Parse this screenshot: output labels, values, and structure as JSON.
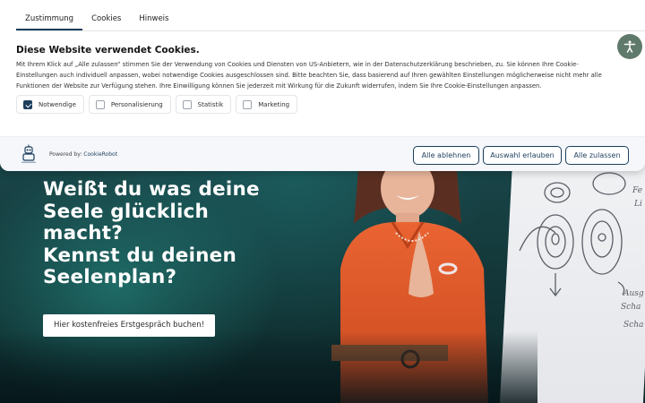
{
  "banner": {
    "tabs": [
      {
        "label": "Zustimmung",
        "active": true
      },
      {
        "label": "Cookies",
        "active": false
      },
      {
        "label": "Hinweis",
        "active": false
      }
    ],
    "title": "Diese Website verwendet Cookies.",
    "description": "Mit Ihrem Klick auf „Alle zulassen“ stimmen Sie der Verwendung von Cookies und Diensten von US-Anbietern, wie in der Datenschutzerklärung beschrieben, zu. Sie können Ihre Cookie-Einstellungen auch individuell anpassen, wobei notwendige Cookies ausgeschlossen sind. Bitte beachten Sie, dass basierend auf Ihren gewählten Einstellungen möglicherweise nicht mehr alle Funktionen der Website zur Verfügung stehen. Ihre Einwilligung können Sie jederzeit mit Wirkung für die Zukunft widerrufen, indem Sie Ihre Cookie-Einstellungen anpassen.",
    "categories": [
      {
        "label": "Notwendige",
        "checked": true
      },
      {
        "label": "Personalisierung",
        "checked": false
      },
      {
        "label": "Statistik",
        "checked": false
      },
      {
        "label": "Marketing",
        "checked": false
      }
    ],
    "powered_prefix": "Powered by:",
    "powered_link": "CookieRobot",
    "buttons": {
      "deny": "Alle ablehnen",
      "selection": "Auswahl erlauben",
      "allow_all": "Alle zulassen"
    }
  },
  "hero": {
    "headline": [
      "Weißt du was deine",
      "Seele glücklich",
      "macht?",
      "Kennst du deinen",
      "Seelenplan?"
    ],
    "cta": "Hier kostenfreies Erstgespräch buchen!"
  },
  "icons": {
    "accessibility": "accessibility-icon",
    "logo": "cookierobot-logo-icon"
  },
  "colors": {
    "accent": "#1c3e5c",
    "accessibility_button": "#5f7a6a",
    "speaker_dress": "#e2582a"
  }
}
